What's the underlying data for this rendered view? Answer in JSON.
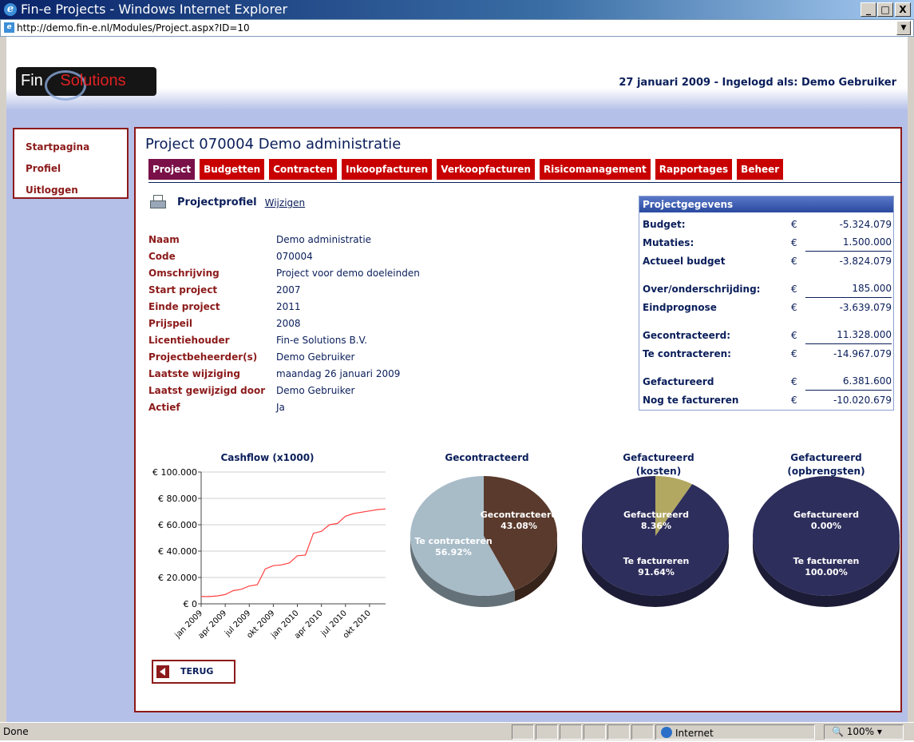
{
  "window": {
    "title": "Fin-e Projects - Windows Internet Explorer",
    "address": "http://demo.fin-e.nl/Modules/Project.aspx?ID=10",
    "minimize": "_",
    "maximize": "□",
    "close": "X"
  },
  "header": {
    "logo_left": "Fin",
    "logo_right": "Solutions",
    "dateline": "27 januari 2009 - Ingelogd als: Demo Gebruiker"
  },
  "menu": {
    "items": [
      {
        "label": "Startpagina"
      },
      {
        "label": "Profiel"
      },
      {
        "label": "Uitloggen"
      }
    ]
  },
  "project": {
    "title": "Project 070004 Demo administratie",
    "tabs": [
      {
        "label": "Project",
        "active": true
      },
      {
        "label": "Budgetten"
      },
      {
        "label": "Contracten"
      },
      {
        "label": "Inkoopfacturen"
      },
      {
        "label": "Verkoopfacturen"
      },
      {
        "label": "Risicomanagement"
      },
      {
        "label": "Rapportages"
      },
      {
        "label": "Beheer"
      }
    ],
    "profile_title": "Projectprofiel",
    "edit_link": "Wijzigen",
    "fields": [
      {
        "label": "Naam",
        "value": "Demo administratie"
      },
      {
        "label": "Code",
        "value": "070004"
      },
      {
        "label": "Omschrijving",
        "value": "Project voor demo doeleinden"
      },
      {
        "label": "Start project",
        "value": "2007"
      },
      {
        "label": "Einde project",
        "value": "2011"
      },
      {
        "label": "Prijspeil",
        "value": "2008"
      },
      {
        "label": "Licentiehouder",
        "value": "Fin-e Solutions B.V."
      },
      {
        "label": "Projectbeheerder(s)",
        "value": "Demo Gebruiker"
      },
      {
        "label": "Laatste wijziging",
        "value": "maandag 26 januari 2009"
      },
      {
        "label": "Laatst gewijzigd door",
        "value": "Demo Gebruiker"
      },
      {
        "label": "Actief",
        "value": "Ja"
      }
    ]
  },
  "projectgegevens": {
    "title": "Projectgegevens",
    "currency": "€",
    "rows": [
      {
        "label": "Budget:",
        "value": "-5.324.079"
      },
      {
        "label": "Mutaties:",
        "value": "1.500.000"
      },
      {
        "label": "Actueel budget",
        "value": "-3.824.079"
      },
      {
        "label": "Over/onderschrijding:",
        "value": "185.000"
      },
      {
        "label": "Eindprognose",
        "value": "-3.639.079"
      },
      {
        "label": "Gecontracteerd:",
        "value": "11.328.000"
      },
      {
        "label": "Te contracteren:",
        "value": "-14.967.079"
      },
      {
        "label": "Gefactureerd",
        "value": "6.381.600"
      },
      {
        "label": "Nog te factureren",
        "value": "-10.020.679"
      }
    ]
  },
  "chart_data": [
    {
      "type": "line",
      "title": "Cashflow (x1000)",
      "y_ticks": [
        "€ 100.000",
        "€ 80.000",
        "€ 60.000",
        "€ 40.000",
        "€ 20.000",
        "€ 0"
      ],
      "ylim": [
        0,
        100000
      ],
      "x_ticks": [
        "jan 2009",
        "apr 2009",
        "jul 2009",
        "okt 2009",
        "jan 2010",
        "apr 2010",
        "jul 2010",
        "okt 2010"
      ],
      "grid": true,
      "color": "#ff4040",
      "series": [
        {
          "x": [
            "jan 2009",
            "feb 2009",
            "mrt 2009",
            "apr 2009",
            "mei 2009",
            "jun 2009",
            "jul 2009",
            "aug 2009",
            "sep 2009",
            "okt 2009",
            "nov 2009",
            "dec 2009",
            "jan 2010",
            "feb 2010",
            "mrt 2010",
            "apr 2010",
            "mei 2010",
            "jun 2010",
            "jul 2010",
            "aug 2010",
            "sep 2010",
            "okt 2010",
            "nov 2010",
            "dec 2010"
          ],
          "values": [
            5500,
            5500,
            6000,
            7000,
            10000,
            11000,
            13500,
            14500,
            26500,
            29000,
            29500,
            31000,
            36500,
            37000,
            53500,
            55000,
            60000,
            61000,
            66500,
            68500,
            69500,
            70500,
            71500,
            72000
          ]
        }
      ]
    },
    {
      "type": "pie",
      "title": "Gecontracteerd",
      "slices": [
        {
          "label": "Gecontracteerd",
          "value": 43.08,
          "value_label": "43.08%",
          "color": "#5a3a2c"
        },
        {
          "label": "Te contracteren",
          "value": 56.92,
          "value_label": "56.92%",
          "color": "#a8bcc8"
        }
      ]
    },
    {
      "type": "pie",
      "title": "Gefactureerd (kosten)",
      "title_lines": [
        "Gefactureerd",
        "(kosten)"
      ],
      "slices": [
        {
          "label": "Gefactureerd",
          "value": 8.36,
          "value_label": "8.36%",
          "color": "#b2a862"
        },
        {
          "label": "Te factureren",
          "value": 91.64,
          "value_label": "91.64%",
          "color": "#2e2e5c"
        }
      ]
    },
    {
      "type": "pie",
      "title": "Gefactureerd (opbrengsten)",
      "title_lines": [
        "Gefactureerd",
        "(opbrengsten)"
      ],
      "slices": [
        {
          "label": "Gefactureerd",
          "value": 0,
          "value_label": "0.00%",
          "color": "#b2a862"
        },
        {
          "label": "Te factureren",
          "value": 100,
          "value_label": "100.00%",
          "color": "#2e2e5c"
        }
      ]
    }
  ],
  "back_button": "TERUG",
  "statusbar": {
    "status": "Done",
    "zone": "Internet",
    "zoom": "100%"
  }
}
